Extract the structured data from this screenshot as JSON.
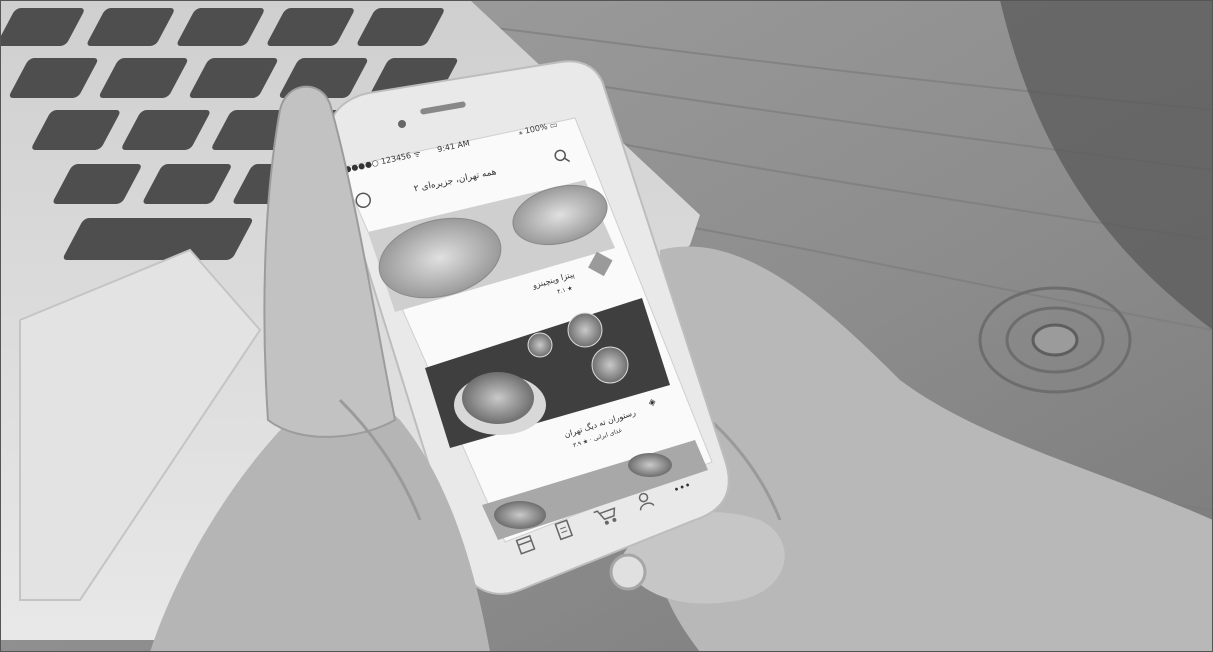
{
  "scene": {
    "description_free": true,
    "colors": {
      "desk": "#8e8e8e",
      "laptop": "#d9d9d9",
      "key": "#555555",
      "phone_body": "#e6e6e6",
      "screen": "#fafafa",
      "skin": "#bdbdbd",
      "skin_shadow": "#9a9a9a"
    }
  },
  "phone": {
    "status": {
      "carrier": "●●●●○ 123456 ᯤ",
      "time": "9:41 AM",
      "battery": "⁎ 100% ▭"
    },
    "header_title": "همه تهران، جزیره‌ای ۲",
    "restaurants": [
      {
        "name": "پیتزا وینچینزو",
        "sub": "۴.۱ ★"
      },
      {
        "name": "رستوران ته دیگ تهران",
        "sub": "۳.۹ ★ · غذای ایرانی"
      }
    ],
    "tab_icons": [
      "calendar-icon",
      "receipt-icon",
      "cart-icon",
      "profile-icon",
      "more-icon"
    ],
    "more_label": "•••"
  }
}
